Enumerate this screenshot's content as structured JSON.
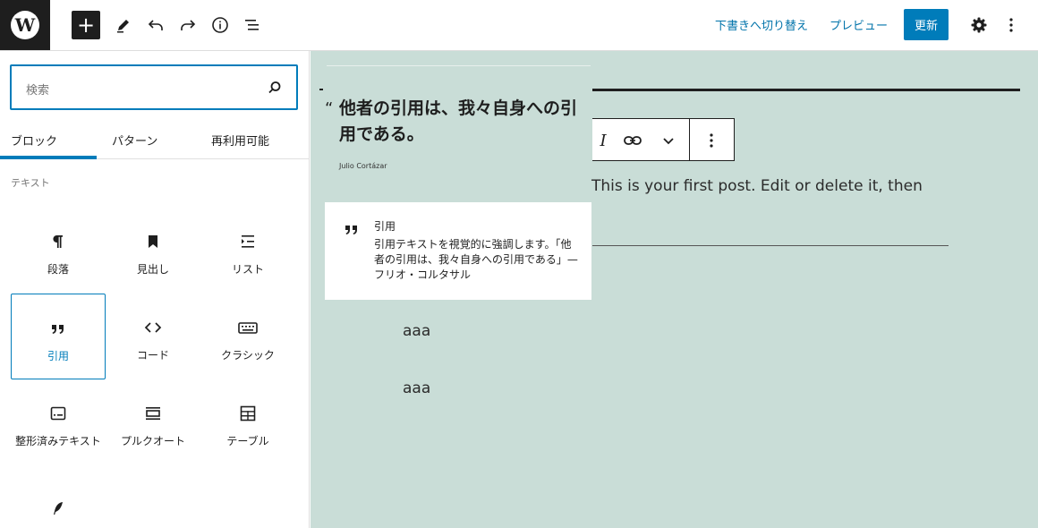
{
  "topbar": {
    "logo_letter": "W",
    "inserter_symbol": "+",
    "switch_to_draft": "下書きへ切り替え",
    "preview": "プレビュー",
    "update": "更新",
    "icons": [
      "wordpress-logo",
      "plus-icon",
      "pencil-icon",
      "undo-icon",
      "redo-icon",
      "info-icon",
      "list-view-icon",
      "gear-icon",
      "more-vertical-icon"
    ]
  },
  "sidebar": {
    "search_placeholder": "検索",
    "tabs": [
      {
        "label": "ブロック"
      },
      {
        "label": "パターン"
      },
      {
        "label": "再利用可能"
      }
    ],
    "section_label": "テキスト",
    "blocks": [
      {
        "label": "段落",
        "icon": "paragraph-icon"
      },
      {
        "label": "見出し",
        "icon": "bookmark-icon"
      },
      {
        "label": "リスト",
        "icon": "list-icon"
      },
      {
        "label": "引用",
        "icon": "quote-icon",
        "selected": true
      },
      {
        "label": "コード",
        "icon": "code-icon"
      },
      {
        "label": "クラシック",
        "icon": "keyboard-icon"
      },
      {
        "label": "整形済みテキスト",
        "icon": "preformatted-icon"
      },
      {
        "label": "プルクオート",
        "icon": "pullquote-icon"
      },
      {
        "label": "テーブル",
        "icon": "table-icon"
      },
      {
        "label": "",
        "icon": "verse-icon"
      }
    ]
  },
  "canvas": {
    "quote_mark": "“",
    "quote_text": "他者の引用は、我々自身への引用である。",
    "quote_cite": "Julio Cortázar",
    "post_text": "This is your first post. Edit or delete it, then",
    "aaa1": "aaa",
    "aaa2": "aaa",
    "toolbar_icons": [
      "italic-icon",
      "link-icon",
      "chevron-down-icon",
      "more-vertical-icon"
    ],
    "italic_glyph": "I"
  },
  "preview_card": {
    "title": "引用",
    "description": "引用テキストを視覚的に強調します。「他者の引用は、我々自身への引用である」—フリオ・コルタサル"
  },
  "colors": {
    "accent": "#007cba",
    "canvas_bg": "#c9ddd7",
    "dark": "#1e1e1e"
  }
}
